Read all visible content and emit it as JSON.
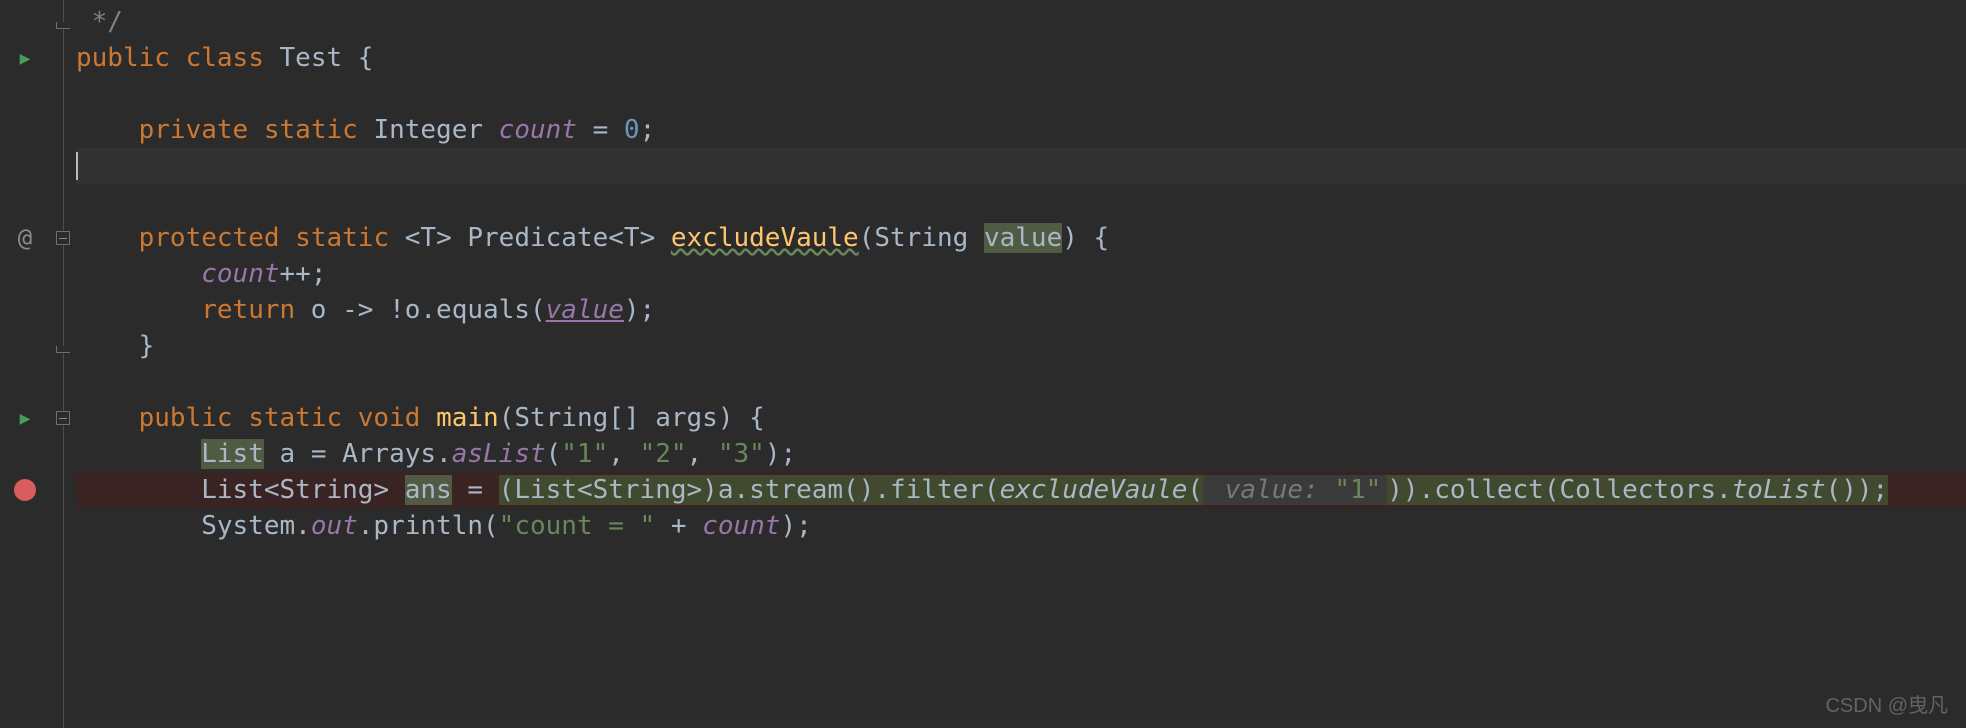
{
  "watermark": "CSDN @曳凡",
  "icons": {
    "run": "▶",
    "at": "@"
  },
  "code": {
    "comment_end": " */",
    "l2": {
      "kw1": "public",
      "kw2": "class",
      "name": "Test",
      "brace": " {"
    },
    "l4": {
      "kw1": "private",
      "kw2": "static",
      "type": "Integer",
      "field": "count",
      "eq": " = ",
      "val": "0",
      "semi": ";"
    },
    "l7": {
      "kw1": "protected",
      "kw2": "static",
      "gen": "<",
      "t": "T",
      "gen2": "> Predicate<",
      "gen3": "> ",
      "fn": "excludeVaule",
      "lp": "(String ",
      "param": "value",
      "rp": ") {"
    },
    "l8": {
      "field": "count",
      "op": "++;"
    },
    "l9": {
      "kw": "return",
      "body": " o -> !o.equals(",
      "param": "value",
      "end": ");"
    },
    "l10": "    }",
    "l12": {
      "kw1": "public",
      "kw2": "static",
      "kw3": "void",
      "fn": "main",
      "args": "(String[] args) {"
    },
    "l13": {
      "type": "List",
      "rest": " a = Arrays.",
      "fn": "asList",
      "lp": "(",
      "s1": "\"1\"",
      "c1": ", ",
      "s2": "\"2\"",
      "c2": ", ",
      "s3": "\"3\"",
      "end": ");"
    },
    "l14": {
      "pre": "        List<String> ",
      "var": "ans",
      "eq": " = ",
      "cast": "(List<String>)a.stream().filter(",
      "call": "excludeVaule",
      "lp": "(",
      "hint": " value: ",
      "arg": "\"1\"",
      "mid": ")).collect(Collectors.",
      "fn": "toList",
      "end": "());"
    },
    "l15": {
      "pre": "        System.",
      "out": "out",
      "dot": ".println(",
      "s": "\"count = \"",
      "plus": " + ",
      "field": "count",
      "end": ");"
    }
  }
}
